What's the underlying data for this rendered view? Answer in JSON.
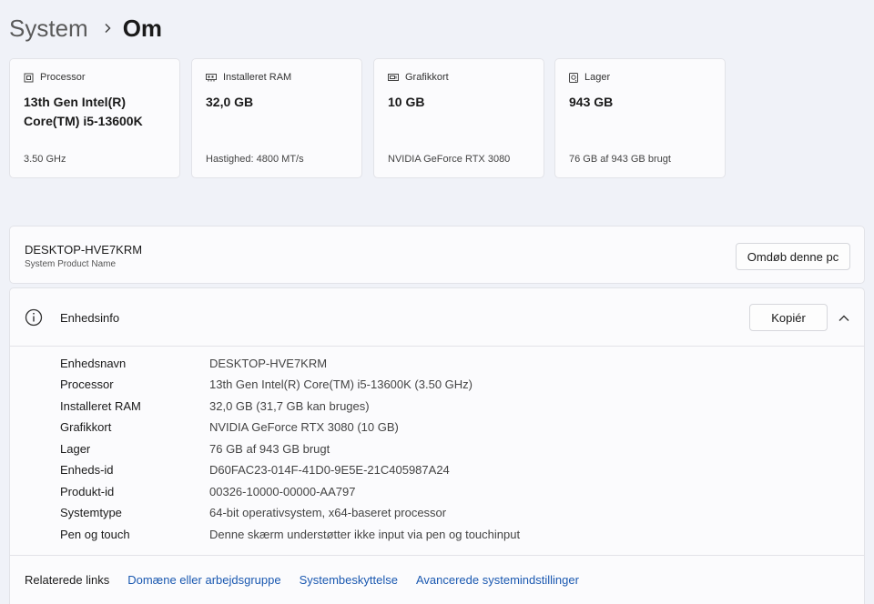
{
  "breadcrumb": {
    "parent": "System",
    "separator": "›",
    "current": "Om"
  },
  "cards": [
    {
      "label": "Processor",
      "icon": "processor-icon",
      "value": "13th Gen Intel(R) Core(TM) i5-13600K",
      "sub": "3.50 GHz"
    },
    {
      "label": "Installeret RAM",
      "icon": "ram-icon",
      "value": "32,0 GB",
      "sub": "Hastighed: 4800 MT/s"
    },
    {
      "label": "Grafikkort",
      "icon": "graphics-card-icon",
      "value": "10 GB",
      "sub": "NVIDIA GeForce RTX 3080"
    },
    {
      "label": "Lager",
      "icon": "storage-icon",
      "value": "943 GB",
      "sub": "76 GB af 943 GB brugt"
    }
  ],
  "device_name_panel": {
    "name": "DESKTOP-HVE7KRM",
    "subtitle": "System Product Name",
    "rename_button": "Omdøb denne pc"
  },
  "device_info": {
    "title": "Enhedsinfo",
    "copy_button": "Kopiér",
    "rows": [
      {
        "label": "Enhedsnavn",
        "value": "DESKTOP-HVE7KRM"
      },
      {
        "label": "Processor",
        "value": "13th Gen Intel(R) Core(TM) i5-13600K (3.50 GHz)"
      },
      {
        "label": "Installeret RAM",
        "value": "32,0 GB (31,7 GB kan bruges)"
      },
      {
        "label": "Grafikkort",
        "value": "NVIDIA GeForce RTX 3080 (10 GB)"
      },
      {
        "label": "Lager",
        "value": "76 GB af 943 GB brugt"
      },
      {
        "label": "Enheds-id",
        "value": "D60FAC23-014F-41D0-9E5E-21C405987A24"
      },
      {
        "label": "Produkt-id",
        "value": "00326-10000-00000-AA797"
      },
      {
        "label": "Systemtype",
        "value": "64-bit operativsystem, x64-baseret processor"
      },
      {
        "label": "Pen og touch",
        "value": "Denne skærm understøtter ikke input via pen og touchinput"
      }
    ]
  },
  "related_links": {
    "title": "Relaterede links",
    "links": [
      "Domæne eller arbejdsgruppe",
      "Systembeskyttelse",
      "Avancerede systemindstillinger"
    ]
  },
  "colors": {
    "link": "#1a58b0",
    "background": "#f0f2f8",
    "card": "#fbfbfd"
  }
}
